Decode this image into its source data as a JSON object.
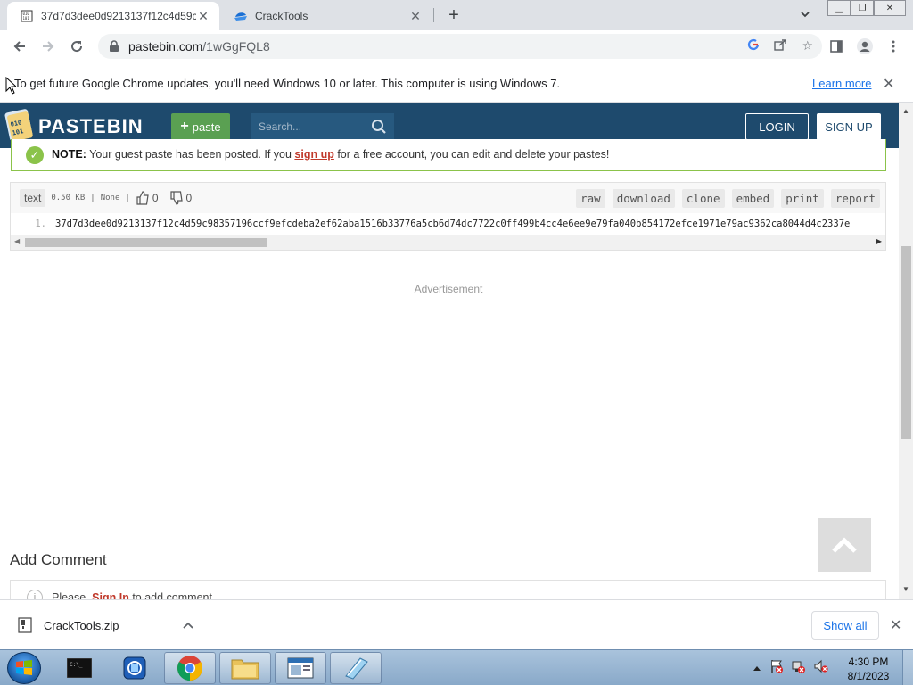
{
  "browser": {
    "tabs": [
      {
        "title": "37d7d3dee0d9213137f12c4d59c",
        "favicon": "pastebin-icon",
        "active": true
      },
      {
        "title": "CrackTools",
        "favicon": "crack-tools-icon",
        "active": false
      }
    ],
    "url_domain": "pastebin.com",
    "url_path": "/1wGgFQL8"
  },
  "infobar": {
    "message": "To get future Google Chrome updates, you'll need Windows 10 or later. This computer is using Windows 7.",
    "link": "Learn more"
  },
  "pastebin": {
    "logo_text": "PASTEBIN",
    "paste_button": "paste",
    "search_placeholder": "Search...",
    "login": "LOGIN",
    "signup": "SIGN UP"
  },
  "note": {
    "label": "NOTE:",
    "text_before": " Your guest paste has been posted. If you ",
    "link": "sign up",
    "text_after": " for a free account, you can edit and delete your pastes!"
  },
  "paste": {
    "syntax": "text",
    "size": "0.50 KB",
    "separator": "|",
    "expiry": "None",
    "likes": "0",
    "dislikes": "0",
    "actions": [
      "raw",
      "download",
      "clone",
      "embed",
      "print",
      "report"
    ],
    "line_number": "1.",
    "content": "37d7d3dee0d9213137f12c4d59c98357196ccf9efcdeba2ef62aba1516b33776a5cb6d74dc7722c0ff499b4cc4e6ee9e79fa040b854172efce1971e79ac9362ca8044d4c2337e"
  },
  "advertisement": "Advertisement",
  "comments": {
    "heading": "Add Comment",
    "prompt_before": "Please, ",
    "prompt_link": "Sign In",
    "prompt_after": " to add comment"
  },
  "downloads": {
    "file": "CrackTools.zip",
    "show_all": "Show all"
  },
  "taskbar": {
    "time": "4:30 PM",
    "date": "8/1/2023"
  },
  "colors": {
    "pastebin_header": "#1e4a6d",
    "paste_green": "#5aa052",
    "note_border": "#8bc34a",
    "link_red": "#c0392b",
    "chrome_blue": "#1a73e8"
  }
}
